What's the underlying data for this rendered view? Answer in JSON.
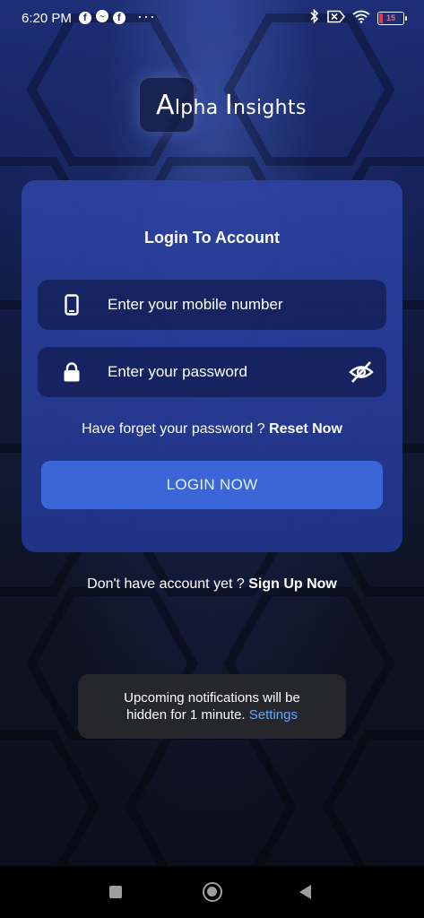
{
  "status_bar": {
    "time": "6:20 PM",
    "app_icons": [
      "facebook-icon",
      "messenger-icon",
      "facebook-icon"
    ],
    "more": "···",
    "right_icons": [
      "bluetooth-icon",
      "no-sim-icon",
      "wifi-icon",
      "battery-icon"
    ],
    "battery_level": "15"
  },
  "logo": {
    "first_letter": "A",
    "rest_first": "lpha ",
    "second_letter": "I",
    "rest_second": "nsights"
  },
  "login_card": {
    "title": "Login To Account",
    "mobile_placeholder": "Enter your mobile number",
    "password_placeholder": "Enter your password",
    "forgot_text": "Have forget your password ?",
    "reset_link": "Reset Now",
    "login_button": "LOGIN NOW"
  },
  "signup": {
    "text": "Don't have account yet ?",
    "link": "Sign Up Now"
  },
  "toast": {
    "line1": "Upcoming notifications will be",
    "line2": "hidden for 1 minute.",
    "link": "Settings"
  },
  "nav": {
    "icons": [
      "recent-apps-icon",
      "home-icon",
      "back-icon"
    ]
  },
  "colors": {
    "card_bg": "#2c42a0",
    "field_bg": "#142058",
    "button_bg": "#3a66d8",
    "toast_link": "#5fa8ff",
    "battery_low": "#e53935"
  }
}
